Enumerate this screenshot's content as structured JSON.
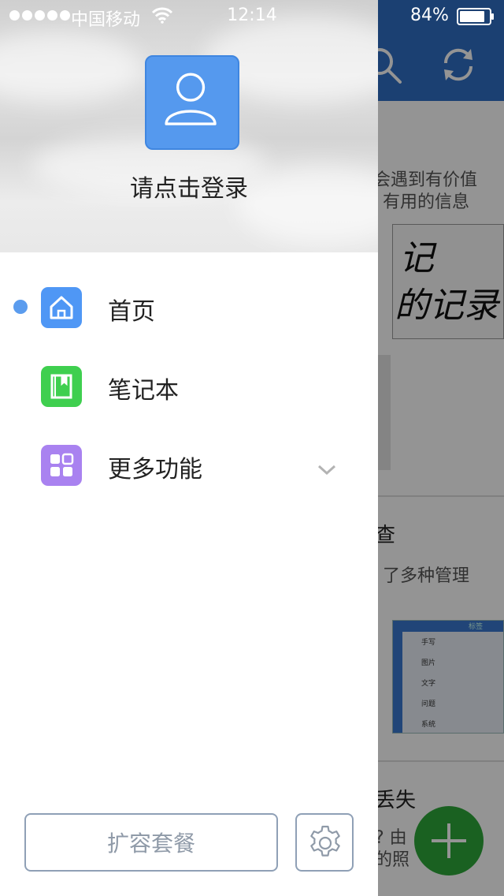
{
  "status_bar": {
    "carrier": "中国移动",
    "time": "12:14",
    "battery": "84%"
  },
  "drawer": {
    "login_prompt": "请点击登录",
    "menu": [
      {
        "label": "首页",
        "icon": "home-icon",
        "color": "#4f97f5",
        "active": true
      },
      {
        "label": "笔记本",
        "icon": "notebook-icon",
        "color": "#3fcf4f",
        "active": false
      },
      {
        "label": "更多功能",
        "icon": "grid-icon",
        "color": "#a982f0",
        "active": false,
        "expandable": true
      }
    ],
    "expand_button_label": "扩容套餐"
  },
  "background_app": {
    "item1_line1": "会遇到有价值",
    "item1_line2": "有用的信息",
    "handwriting_line1": "记",
    "handwriting_line2": "的记录",
    "item2_title": "查",
    "item2_line1": "了多种管理",
    "screenshot_header": "标签",
    "screenshot_rows": [
      "手写",
      "图片",
      "文字",
      "问题",
      "系统"
    ],
    "item3_title": "丢失",
    "item3_line1": "? 由",
    "item3_line2": "的照"
  },
  "colors": {
    "accent_blue": "#5599ee",
    "home_icon_bg": "#4f97f5",
    "notebook_icon_bg": "#3fcf4f",
    "more_icon_bg": "#a982f0",
    "fab_green": "#2ea83a"
  }
}
